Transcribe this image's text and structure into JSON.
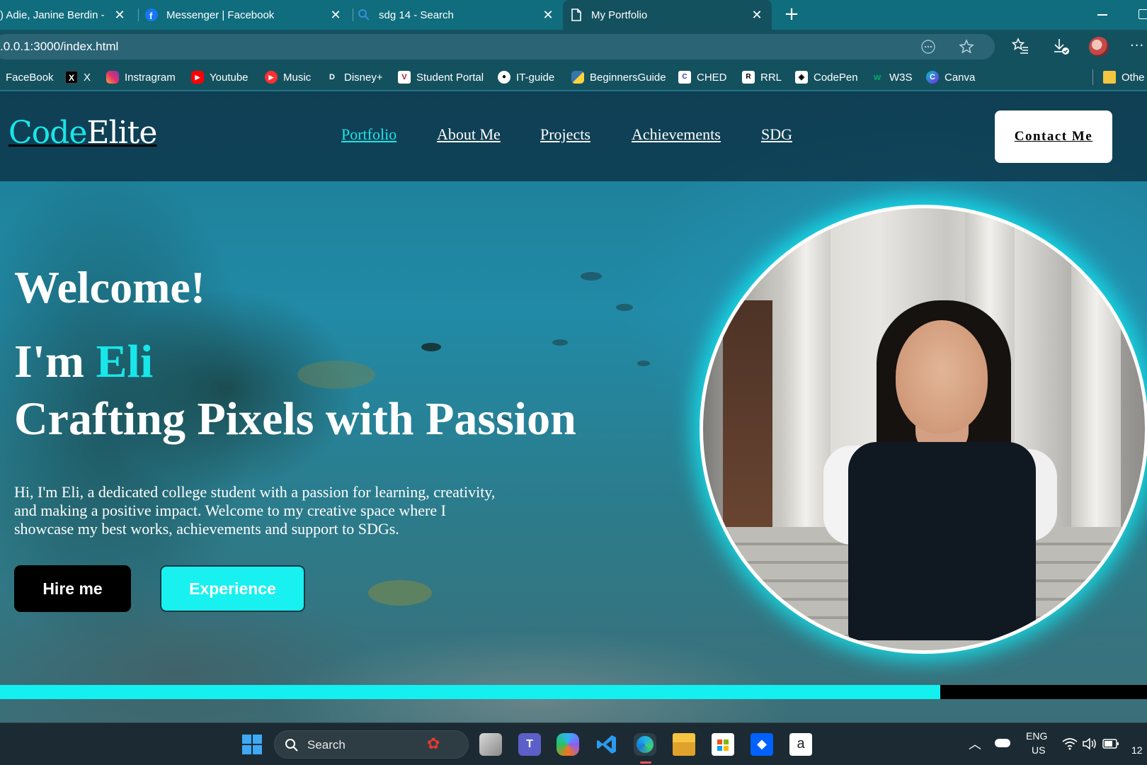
{
  "browser": {
    "tabs": [
      {
        "title": ") Adie, Janine Berdin - M",
        "icon": "messenger-icon"
      },
      {
        "title": "Messenger | Facebook",
        "icon": "facebook-icon"
      },
      {
        "title": "sdg 14 - Search",
        "icon": "search-icon"
      },
      {
        "title": "My Portfolio",
        "icon": "page-icon"
      }
    ],
    "address": ".0.0.1:3000/index.html",
    "bookmarks": [
      {
        "label": "FaceBook",
        "icon": "facebook-icon"
      },
      {
        "label": "X",
        "icon": "x-icon"
      },
      {
        "label": "Instragram",
        "icon": "instagram-icon"
      },
      {
        "label": "Youtube",
        "icon": "youtube-icon"
      },
      {
        "label": "Music",
        "icon": "music-icon"
      },
      {
        "label": "Disney+",
        "icon": "disney-icon"
      },
      {
        "label": "Student Portal",
        "icon": "portal-icon"
      },
      {
        "label": "IT-guide",
        "icon": "github-icon"
      },
      {
        "label": "BeginnersGuide",
        "icon": "python-icon"
      },
      {
        "label": "CHED",
        "icon": "ched-icon"
      },
      {
        "label": "RRL",
        "icon": "rrl-icon"
      },
      {
        "label": "CodePen",
        "icon": "codepen-icon"
      },
      {
        "label": "W3S",
        "icon": "w3s-icon"
      },
      {
        "label": "Canva",
        "icon": "canva-icon"
      },
      {
        "label": "Othe",
        "icon": "folder-icon"
      }
    ]
  },
  "site": {
    "logo_part1": "Code",
    "logo_part2": "Elite",
    "nav": [
      {
        "label": "Portfolio",
        "active": true
      },
      {
        "label": "About Me",
        "active": false
      },
      {
        "label": "Projects",
        "active": false
      },
      {
        "label": "Achievements",
        "active": false
      },
      {
        "label": "SDG",
        "active": false
      }
    ],
    "contact_label": "Contact Me",
    "welcome": "Welcome!",
    "im_prefix": "I'm ",
    "name": "Eli",
    "tagline": "Crafting Pixels with Passion",
    "intro": "Hi, I'm Eli, a dedicated college student with a passion for learning, creativity, and making a positive impact. Welcome to my creative space where I showcase my best works, achievements and support to SDGs.",
    "hire_label": "Hire me",
    "experience_label": "Experience",
    "scroll_progress": 0.82,
    "accent": "#19e6e8"
  },
  "taskbar": {
    "search_label": "Search",
    "lang_line1": "ENG",
    "lang_line2": "US",
    "clock": "12"
  }
}
